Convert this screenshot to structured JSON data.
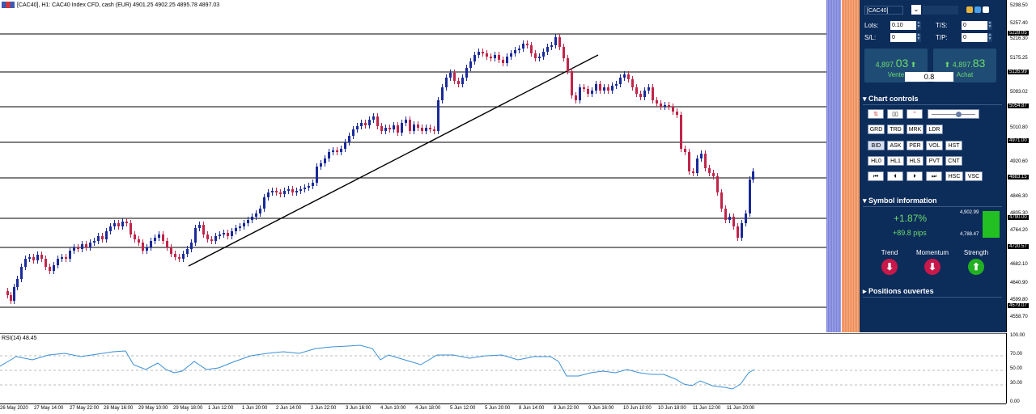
{
  "header": {
    "title": "[CAC40], H1:  CAC40 Index CFD, cash (EUR)  4901.25 4902.25 4895.78 4897.03"
  },
  "rsi": {
    "title": "RSI(14) 48.45",
    "levels": [
      "100.00",
      "70.00",
      "50.00",
      "30.00",
      "0.00"
    ]
  },
  "price_axis": {
    "labels": [
      "5298.50",
      "5257.40",
      "5216.30",
      "5175.25",
      "5093.02",
      "5010.80",
      "4920.60",
      "4846.30",
      "4805.30",
      "4764.20",
      "4682.10",
      "4640.90",
      "4599.80",
      "4558.70"
    ],
    "tags": [
      "5228.05",
      "5135.99",
      "5054.87",
      "4971.00",
      "4883.15",
      "4790.00",
      "4720.57",
      "4579.07"
    ]
  },
  "time_axis": {
    "labels": [
      "26 May 2020",
      "27 May 14:00",
      "27 May 22:00",
      "28 May 16:00",
      "29 May 10:00",
      "29 May 18:00",
      "1 Jun 12:00",
      "1 Jun 20:00",
      "2 Jun 14:00",
      "2 Jun 22:00",
      "3 Jun 16:00",
      "4 Jun 10:00",
      "4 Jun 18:00",
      "5 Jun 12:00",
      "5 Jun 20:00",
      "8 Jun 14:00",
      "8 Jun 22:00",
      "9 Jun 16:00",
      "10 Jun 10:00",
      "10 Jun 18:00",
      "11 Jun 12:00",
      "11 Jun 20:00"
    ]
  },
  "panel": {
    "symbol": "[CAC40]",
    "lots_label": "Lots:",
    "lots_value": "0.10",
    "ts_label": "T/S:",
    "ts_value": "0",
    "sl_label": "S/L:",
    "sl_value": "0",
    "tp_label": "T/P:",
    "tp_value": "0",
    "sell": {
      "prefix": "4,897.",
      "big": "03",
      "label": "Vente"
    },
    "buy": {
      "prefix": "4,897.",
      "big": "83",
      "label": "Achat"
    },
    "spread": "0.8",
    "chart_controls": "Chart controls",
    "buttons_row2": [
      "GRD",
      "TRD",
      "MRK",
      "LDR"
    ],
    "buttons_row3": [
      "BID",
      "ASK",
      "PER",
      "VOL",
      "HST"
    ],
    "buttons_row4": [
      "HL0",
      "HL1",
      "HLS",
      "PVT",
      "CNT"
    ],
    "buttons_row5_text": [
      "HSC",
      "VSC"
    ],
    "symbol_info": "Symbol information",
    "change_pct": "+1.87%",
    "change_pips": "+89.8 pips",
    "high": "4,902.99",
    "low": "4,788.47",
    "trend": "Trend",
    "momentum": "Momentum",
    "strength": "Strength",
    "positions": "Positions ouvertes"
  },
  "colors": {
    "up": "#1a2a9a",
    "down": "#c0254a",
    "panel": "#0c2c5a",
    "green": "#6ddc6d"
  }
}
